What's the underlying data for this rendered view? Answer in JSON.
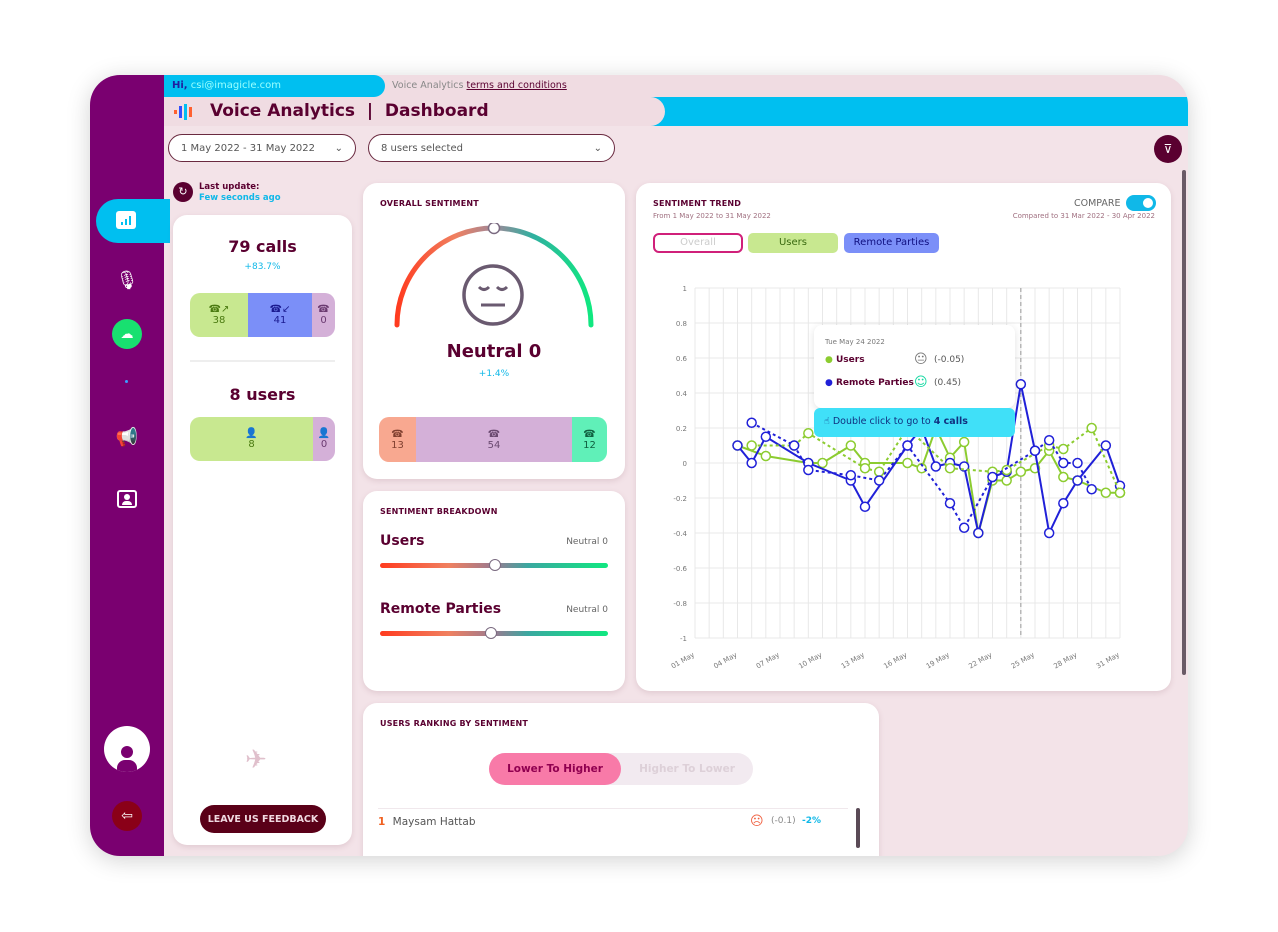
{
  "header": {
    "greeting": "Hi,",
    "email": "csi@imagicle.com",
    "app_name": "Voice Analytics",
    "terms_link": "terms and conditions",
    "title": "Voice Analytics  |  Dashboard"
  },
  "filters": {
    "date_range": "1 May 2022 - 31 May 2022",
    "users": "8 users selected"
  },
  "last_update": {
    "label": "Last update:",
    "value": "Few seconds ago"
  },
  "calls": {
    "total": "79 calls",
    "change": "+83.7%",
    "outgoing": "38",
    "incoming": "41",
    "other": "0"
  },
  "users": {
    "total": "8 users",
    "active": "8",
    "inactive": "0"
  },
  "feedback_button": "LEAVE US FEEDBACK",
  "overall": {
    "title": "OVERALL SENTIMENT",
    "label": "Neutral 0",
    "change": "+1.4%",
    "negative": "13",
    "neutral": "54",
    "positive": "12",
    "gauge_value": 0
  },
  "breakdown": {
    "title": "SENTIMENT BREAKDOWN",
    "users_label": "Users",
    "users_value": "Neutral 0",
    "users_level": 0,
    "remote_label": "Remote Parties",
    "remote_value": "Neutral 0",
    "remote_level": -0.04
  },
  "trend": {
    "title": "SENTIMENT TREND",
    "subtitle": "From 1 May 2022 to 31 May 2022",
    "compare_label": "COMPARE",
    "compare_on": true,
    "compare_range": "Compared to 31 Mar 2022 - 30 Apr 2022",
    "tabs": [
      "Overall",
      "Users",
      "Remote Parties"
    ],
    "tooltip": {
      "date": "Tue May 24 2022",
      "users_label": "Users",
      "users_value": "(-0.05)",
      "remote_label": "Remote Parties",
      "remote_value": "(0.45)",
      "action_prefix": "Double click to go to ",
      "action_bold": "4 calls"
    }
  },
  "ranking": {
    "title": "USERS RANKING BY SENTIMENT",
    "sort_options": [
      "Lower To Higher",
      "Higher To Lower"
    ],
    "rows": [
      {
        "rank": "1",
        "name": "Maysam Hattab",
        "score": "(-0.1)",
        "change": "-2%"
      }
    ]
  },
  "colors": {
    "sidebar": "#7a0070",
    "accent": "#00bff0",
    "users": "#8ccc30",
    "remote": "#2020d8",
    "maroon": "#5a0030"
  },
  "chart_data": {
    "type": "line",
    "ylim": [
      -1,
      1
    ],
    "yticks": [
      "1",
      "0.8",
      "0.6",
      "0.4",
      "0.2",
      "0",
      "-0.2",
      "-0.4",
      "-0.6",
      "-0.8",
      "-1"
    ],
    "xticks": [
      "01 May",
      "04 May",
      "07 May",
      "10 May",
      "13 May",
      "16 May",
      "19 May",
      "22 May",
      "25 May",
      "28 May",
      "31 May"
    ],
    "grid": true,
    "highlight_day": 24,
    "series": [
      {
        "name": "Users",
        "style": "solid",
        "color": "#8ccc30",
        "points": [
          [
            4,
            0.1
          ],
          [
            6,
            0.04
          ],
          [
            9,
            0
          ],
          [
            10,
            0
          ],
          [
            12,
            0.1
          ],
          [
            13,
            0
          ],
          [
            16,
            0
          ],
          [
            17,
            -0.03
          ],
          [
            18,
            0.2
          ],
          [
            19,
            0.03
          ],
          [
            20,
            0.12
          ],
          [
            21,
            -0.4
          ],
          [
            22,
            -0.1
          ],
          [
            23,
            -0.1
          ],
          [
            24,
            -0.05
          ],
          [
            25,
            -0.03
          ],
          [
            26,
            0.07
          ],
          [
            27,
            -0.08
          ],
          [
            28,
            -0.1
          ],
          [
            30,
            -0.17
          ],
          [
            31,
            -0.17
          ]
        ]
      },
      {
        "name": "Remote Parties",
        "style": "solid",
        "color": "#2020d8",
        "points": [
          [
            4,
            0.1
          ],
          [
            5,
            0
          ],
          [
            6,
            0.15
          ],
          [
            9,
            0
          ],
          [
            12,
            -0.1
          ],
          [
            13,
            -0.25
          ],
          [
            16,
            0.1
          ],
          [
            17,
            0.2
          ],
          [
            18,
            -0.02
          ],
          [
            19,
            0
          ],
          [
            20,
            -0.02
          ],
          [
            21,
            -0.4
          ],
          [
            22,
            -0.08
          ],
          [
            23,
            -0.05
          ],
          [
            24,
            0.45
          ],
          [
            25,
            0.07
          ],
          [
            26,
            -0.4
          ],
          [
            27,
            -0.23
          ],
          [
            28,
            -0.1
          ],
          [
            30,
            0.1
          ],
          [
            31,
            -0.13
          ]
        ]
      },
      {
        "name": "Users",
        "style": "dashed",
        "color": "#8ccc30",
        "points": [
          [
            5,
            0.1
          ],
          [
            8,
            0.1
          ],
          [
            9,
            0.17
          ],
          [
            13,
            -0.03
          ],
          [
            14,
            -0.05
          ],
          [
            16,
            0.2
          ],
          [
            19,
            -0.03
          ],
          [
            22,
            -0.05
          ],
          [
            23,
            -0.04
          ],
          [
            26,
            0.1
          ],
          [
            27,
            0.08
          ],
          [
            29,
            0.2
          ],
          [
            31,
            -0.17
          ]
        ]
      },
      {
        "name": "Remote Parties",
        "style": "dashed",
        "color": "#2020d8",
        "points": [
          [
            5,
            0.23
          ],
          [
            8,
            0.1
          ],
          [
            9,
            -0.04
          ],
          [
            12,
            -0.07
          ],
          [
            14,
            -0.1
          ],
          [
            16,
            0.1
          ],
          [
            19,
            -0.23
          ],
          [
            20,
            -0.37
          ],
          [
            22,
            -0.08
          ],
          [
            25,
            0.07
          ],
          [
            26,
            0.13
          ],
          [
            27,
            0
          ],
          [
            28,
            0
          ],
          [
            29,
            -0.15
          ]
        ]
      }
    ]
  }
}
